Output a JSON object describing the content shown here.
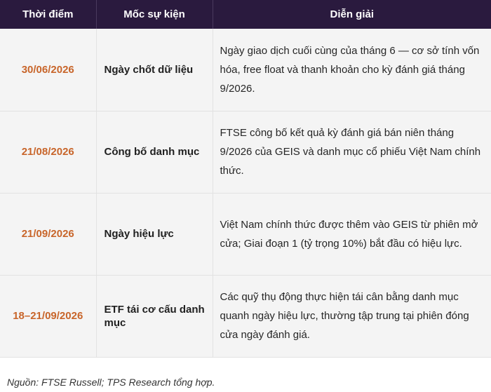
{
  "table": {
    "headers": [
      "Thời điểm",
      "Mốc sự kiện",
      "Diễn giải"
    ],
    "rows": [
      {
        "date": "30/06/2026",
        "event": "Ngày chốt dữ liệu",
        "desc": "Ngày giao dịch cuối cùng của tháng 6 — cơ sở tính vốn hóa, free float và thanh khoản cho kỳ đánh giá tháng 9/2026."
      },
      {
        "date": "21/08/2026",
        "event": "Công bố danh mục",
        "desc": "FTSE công bố kết quả kỳ đánh giá bán niên tháng 9/2026 của GEIS và danh mục cổ phiếu Việt Nam chính thức."
      },
      {
        "date": "21/09/2026",
        "event": "Ngày hiệu lực",
        "desc": "Việt Nam chính thức được thêm vào GEIS từ phiên mở cửa; Giai đoạn 1 (tỷ trọng 10%) bắt đầu có hiệu lực."
      },
      {
        "date": "18–21/09/2026",
        "event": "ETF tái cơ cấu danh mục",
        "desc": "Các quỹ thụ động thực hiện tái cân bằng danh mục quanh ngày hiệu lực, thường tập trung tại phiên đóng cửa ngày đánh giá."
      }
    ]
  },
  "source": "Nguồn: FTSE Russell; TPS Research tổng hợp.",
  "colors": {
    "header_bg": "#2a1a3e",
    "date_text": "#c8652a",
    "row_bg": "#f4f4f4"
  }
}
